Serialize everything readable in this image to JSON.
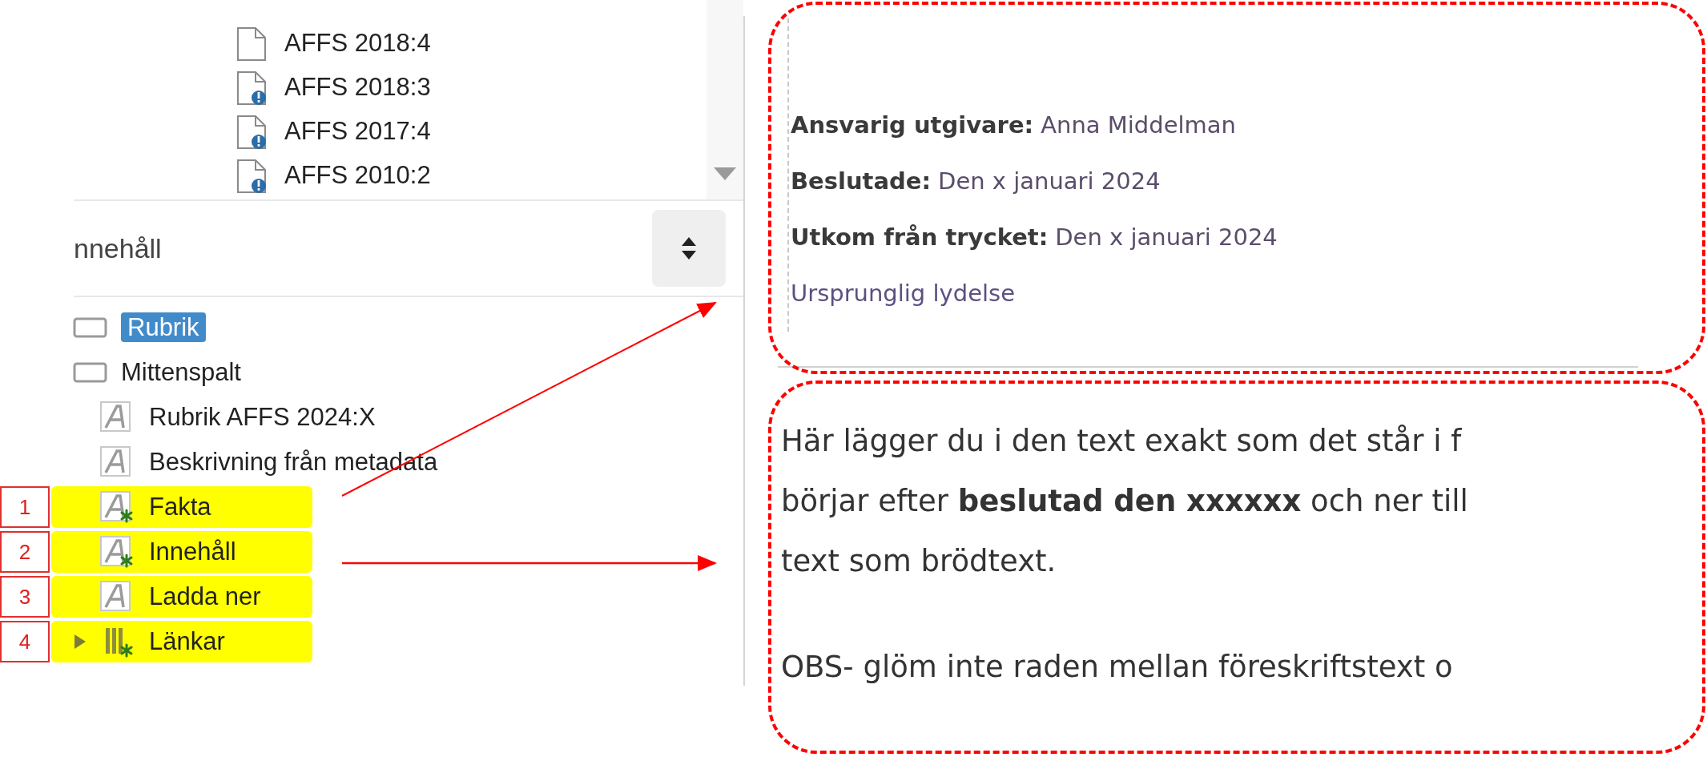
{
  "file_list": {
    "items": [
      {
        "label": "AFFS 2018:4",
        "kind": "plain"
      },
      {
        "label": "AFFS 2018:3",
        "kind": "notice"
      },
      {
        "label": "AFFS 2017:4",
        "kind": "notice"
      },
      {
        "label": "AFFS 2010:2",
        "kind": "notice"
      }
    ]
  },
  "content_panel": {
    "title": "nnehåll"
  },
  "tree": [
    {
      "label": "Rubrik",
      "kind": "container",
      "selected": true,
      "highlighted": false
    },
    {
      "label": "Mittenspalt",
      "kind": "container",
      "selected": false,
      "highlighted": false,
      "children": [
        {
          "label": "Rubrik AFFS 2024:X",
          "kind": "text",
          "selected": false,
          "highlighted": false,
          "starred": false
        },
        {
          "label": "Beskrivning från metadata",
          "kind": "text",
          "selected": false,
          "highlighted": false,
          "starred": false
        },
        {
          "label": "Fakta",
          "kind": "text",
          "selected": false,
          "highlighted": true,
          "starred": true,
          "marker": "1"
        },
        {
          "label": "Innehåll",
          "kind": "text",
          "selected": false,
          "highlighted": true,
          "starred": true,
          "marker": "2"
        },
        {
          "label": "Ladda ner",
          "kind": "text",
          "selected": false,
          "highlighted": true,
          "starred": false,
          "marker": "3"
        },
        {
          "label": "Länkar",
          "kind": "list",
          "selected": false,
          "highlighted": true,
          "starred": true,
          "expanded": false,
          "marker": "4"
        }
      ]
    }
  ],
  "preview": {
    "facts": [
      {
        "label": "Ansvarig utgivare:",
        "value": "Anna Middelman"
      },
      {
        "label": "Beslutade:",
        "value": "Den x januari 2024"
      },
      {
        "label": "Utkom från trycket:",
        "value": "Den x januari 2024"
      }
    ],
    "note": "Ursprunglig lydelse",
    "body": [
      {
        "lines": [
          "Här lägger du i den text exakt som det står i f",
          "börjar efter **beslutad den xxxxxx** och ner till",
          "text som brödtext."
        ]
      },
      {
        "lines": [
          "OBS- glöm inte raden mellan föreskriftstext o"
        ]
      }
    ]
  }
}
